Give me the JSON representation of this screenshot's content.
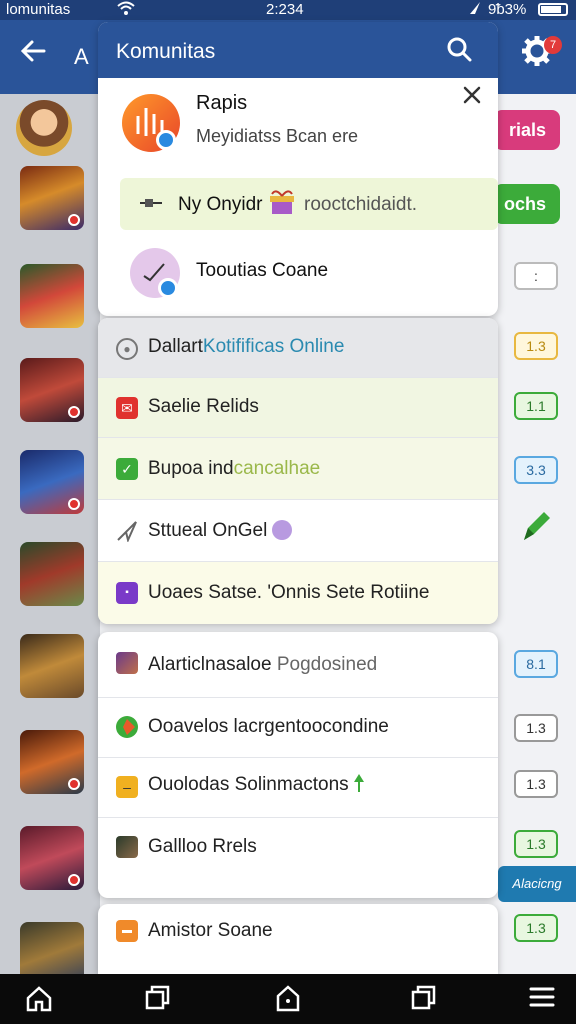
{
  "status_bar": {
    "carrier": "lomunitas",
    "time": "2:234",
    "battery": "9ᵬ3%"
  },
  "app_bar": {
    "title_fragment": "A",
    "settings_badge": "7"
  },
  "sheet": {
    "title": "Komunitas",
    "card": {
      "name": "Rapis",
      "subtitle": "Meyidiatss Bcan ere",
      "banner_text": "Ny Onyidr",
      "banner_text_2": "rooctchidaidt.",
      "item_label": "Tooutias Coane"
    },
    "menu": [
      {
        "label_a": "Dallart",
        "label_b": "Kotifificas Online"
      },
      {
        "label_a": "Saelie Relids",
        "label_b": ""
      },
      {
        "label_a": "Bupoa ind",
        "label_b": "cancalhae"
      },
      {
        "label_a": "Sttueal OnGel",
        "label_b": ""
      },
      {
        "label_a": "Uoaes Satse. 'Onnis Sete Rotiine",
        "label_b": ""
      }
    ],
    "list": [
      {
        "label_a": "Alarticlnasaloe",
        "label_b": "Pogdosined"
      },
      {
        "label_a": "Ooavelos lacrgentoocondine",
        "label_b": ""
      },
      {
        "label_a": "Ouolodas Solinmactons",
        "label_b": ""
      },
      {
        "label_a": "Gallloo Rrels",
        "label_b": ""
      }
    ],
    "last_item": "Amistor Soane"
  },
  "right_column": {
    "btn_pink": "rials",
    "btn_green": "ochs",
    "pill_1": ":",
    "pill_2": "1.3",
    "pill_3": "1.1",
    "pill_4": "3.3",
    "pill_6": "8.1",
    "pill_7": "1.3",
    "pill_8": "1.3",
    "pill_9": "1.3",
    "pill_10": "1.3",
    "tag": "Alacicng"
  },
  "colors": {
    "header_blue": "#2a5499",
    "pink": "#d83b7c",
    "green": "#3cab3a"
  }
}
